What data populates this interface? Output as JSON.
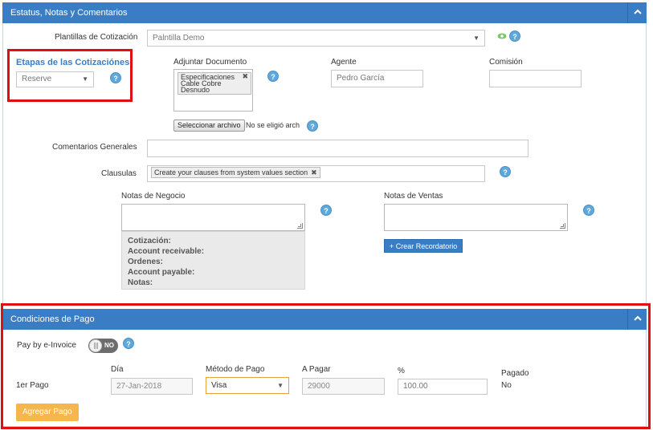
{
  "status_panel": {
    "title": "Estatus, Notas y Comentarios",
    "template_label": "Plantillas de Cotización",
    "template_value": "Palntilla Demo",
    "stage_label": "Etapas de las Cotizaciónes",
    "stage_value": "Reserve",
    "attach_label": "Adjuntar Documento",
    "attached_doc_tag": "Especificaciones Cable Cobre Desnudo",
    "attached_doc_lines": [
      "Especificaciones",
      "Cable Cobre",
      "Desnudo"
    ],
    "file_button_label": "Seleccionar archivo",
    "file_status": "No se eligió arch",
    "agent_label": "Agente",
    "agent_placeholder": "Pedro García",
    "commission_label": "Comisión",
    "commission_value": "",
    "comments_label": "Comentarios Generales",
    "comments_value": "",
    "clauses_label": "Clausulas",
    "clause_tag": "Create your clauses from system values section",
    "business_notes_label": "Notas de Negocio",
    "sales_notes_label": "Notas de Ventas",
    "summary_lines": [
      "Cotización:",
      "Account receivable:",
      "Ordenes:",
      "Account payable:",
      "Notas:"
    ],
    "reminder_button_label": "+ Crear Recordatorio",
    "accent_color": "#3a7dc4",
    "highlight_color": "#e01010"
  },
  "payment_panel": {
    "title": "Condiciones de Pago",
    "einvoice_label": "Pay by e-Invoice",
    "einvoice_toggle_text": "NO",
    "columns": {
      "day": "Día",
      "method": "Método de Pago",
      "to_pay": "A Pagar",
      "percent": "%",
      "paid": "Pagado"
    },
    "rows": [
      {
        "label": "1er Pago",
        "day": "27-Jan-2018",
        "method": "Visa",
        "to_pay": "29000",
        "percent": "100.00",
        "paid": "No"
      }
    ],
    "add_payment_label": "Agregar Pago"
  },
  "icons": {
    "help": "help-circle-icon",
    "eye": "eye-icon",
    "collapse": "chevron-up-icon",
    "remove": "remove-tag-icon"
  }
}
